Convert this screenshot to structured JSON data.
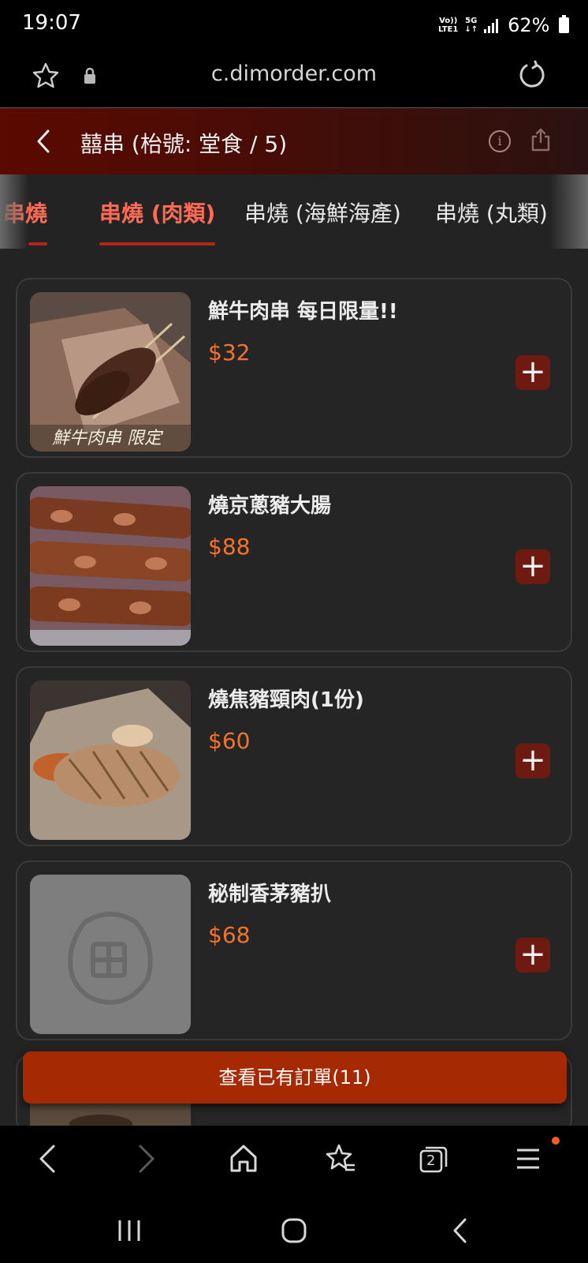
{
  "status": {
    "time": "19:07",
    "net1": "Vo))",
    "net2": "LTE1",
    "net3": "5G",
    "net4": "↓↑",
    "battery": "62%"
  },
  "browser": {
    "url": "c.dimorder.com",
    "tab_count": "2"
  },
  "header": {
    "title": "囍串 (枱號: 堂食 / 5)"
  },
  "tabs": [
    {
      "label": "串燒"
    },
    {
      "label": "串燒 (肉類)"
    },
    {
      "label": "串燒 (海鮮海產)"
    },
    {
      "label": "串燒 (丸類)"
    }
  ],
  "items": [
    {
      "name": "鮮牛肉串 每日限量!!",
      "price": "$32",
      "photo_caption": "鮮牛肉串 限定"
    },
    {
      "name": "燒京蔥豬大腸",
      "price": "$88"
    },
    {
      "name": "燒焦豬頸肉(1份)",
      "price": "$60"
    },
    {
      "name": "秘制香茅豬扒",
      "price": "$68"
    }
  ],
  "order_button": "查看已有訂單(11)",
  "colors": {
    "accent": "#ff6a55",
    "price": "#f0742f",
    "order": "#a52a04",
    "header": "#5a0a00"
  }
}
